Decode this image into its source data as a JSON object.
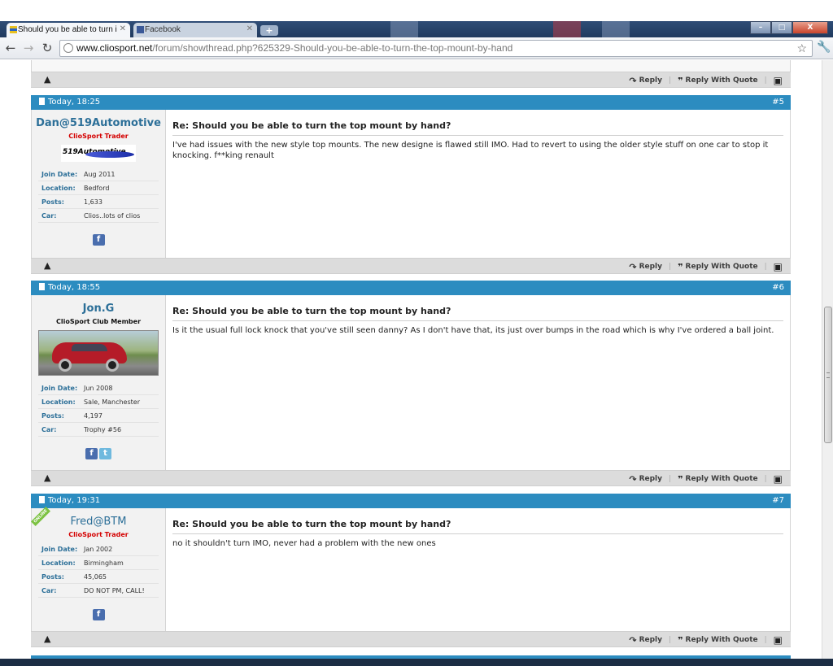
{
  "browser": {
    "tabs": [
      {
        "label": "Should you be able to turn i",
        "active": true
      },
      {
        "label": "Facebook",
        "active": false
      }
    ],
    "url_host": "www.cliosport.net",
    "url_path": "/forum/showthread.php?625329-Should-you-be-able-to-turn-the-top-mount-by-hand",
    "window_buttons": {
      "minimize": "–",
      "maximize": "□",
      "close": "X"
    }
  },
  "post_actions": {
    "reply": "Reply",
    "reply_with_quote": "Reply With Quote"
  },
  "posts": [
    {
      "date": "Today, 18:25",
      "number": "#5",
      "username": "Dan@519Automotive",
      "user_title": "ClioSport Trader",
      "logo_text": "519Automotive",
      "stats": [
        {
          "label": "Join Date:",
          "value": "Aug 2011"
        },
        {
          "label": "Location:",
          "value": "Bedford"
        },
        {
          "label": "Posts:",
          "value": "1,633"
        },
        {
          "label": "Car:",
          "value": "Clios..lots of clios"
        }
      ],
      "title": "Re: Should you be able to turn the top mount by hand?",
      "body": "I've had issues with the new style top mounts. The new designe is flawed still IMO. Had to revert to using the older style stuff on one car to stop it knocking. f**king renault"
    },
    {
      "date": "Today, 18:55",
      "number": "#6",
      "username": "Jon.G",
      "user_title": "ClioSport Club Member",
      "stats": [
        {
          "label": "Join Date:",
          "value": "Jun 2008"
        },
        {
          "label": "Location:",
          "value": "Sale, Manchester"
        },
        {
          "label": "Posts:",
          "value": "4,197"
        },
        {
          "label": "Car:",
          "value": "Trophy #56"
        }
      ],
      "title": "Re: Should you be able to turn the top mount by hand?",
      "body": "Is it the usual full lock knock that you've still seen danny? As I don't have that, its just over bumps in the road which is why I've ordered a ball joint."
    },
    {
      "date": "Today, 19:31",
      "number": "#7",
      "username": "Fred@BTM",
      "user_title": "ClioSport Trader",
      "online_label": "ONLINE",
      "stats": [
        {
          "label": "Join Date:",
          "value": "Jan 2002"
        },
        {
          "label": "Location:",
          "value": "Birmingham"
        },
        {
          "label": "Posts:",
          "value": "45,065"
        },
        {
          "label": "Car:",
          "value": "DO NOT PM, CALL!"
        }
      ],
      "title": "Re: Should you be able to turn the top mount by hand?",
      "body": "no it shouldn't turn IMO, never had a problem with the new ones"
    }
  ],
  "colors": {
    "header_blue": "#2c8cc0",
    "username_blue": "#2c6f98",
    "trader_red": "#d40000"
  }
}
